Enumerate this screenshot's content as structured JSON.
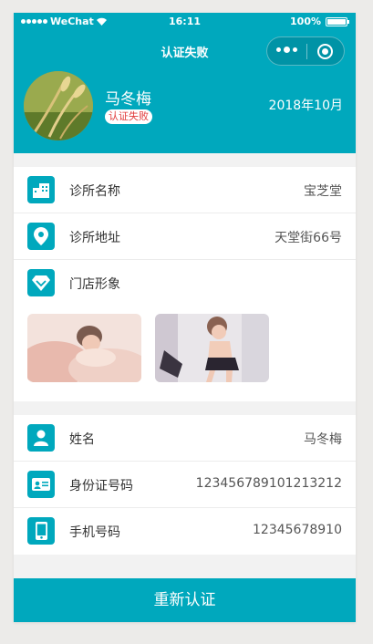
{
  "status_bar": {
    "carrier": "WeChat",
    "time": "16:11",
    "battery": "100%"
  },
  "nav": {
    "title": "认证失败"
  },
  "profile": {
    "name": "马冬梅",
    "status": "认证失败",
    "date": "2018年10月"
  },
  "clinic": {
    "name_label": "诊所名称",
    "name_value": "宝芝堂",
    "address_label": "诊所地址",
    "address_value": "天堂街66号",
    "image_label": "门店形象"
  },
  "person": {
    "name_label": "姓名",
    "name_value": "马冬梅",
    "id_label": "身份证号码",
    "id_value": "123456789101213212",
    "phone_label": "手机号码",
    "phone_value": "12345678910"
  },
  "action": {
    "button_label": "重新认证"
  },
  "colors": {
    "brand": "#00a8bd",
    "error": "#e03a3a"
  }
}
